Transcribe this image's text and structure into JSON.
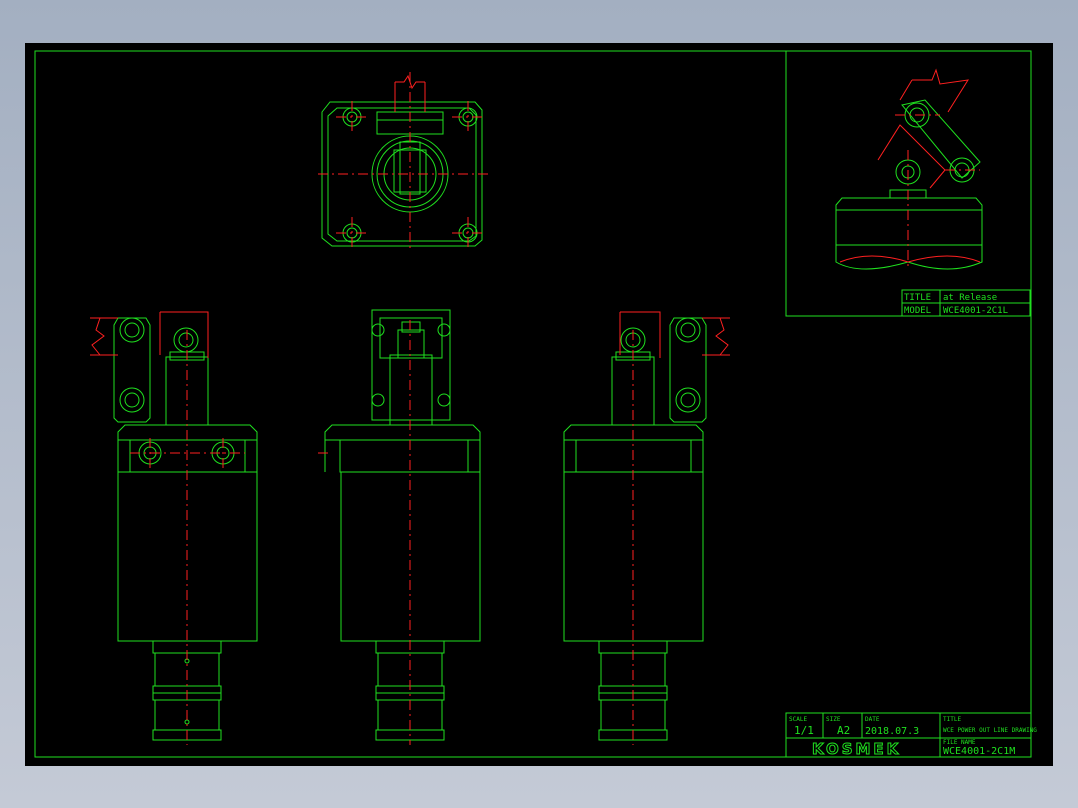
{
  "title_block": {
    "scale_label": "SCALE",
    "scale_value": "1/1",
    "size_label": "SIZE",
    "size_value": "A2",
    "date_label": "DATE",
    "date_value": "2018.07.3",
    "title_label": "TITLE",
    "title_value": "WCE  POWER  OUT  LINE  DRAWING",
    "file_label": "FILE NAME",
    "file_value": "WCE4001-2C1M",
    "company_logo": "KOSMEK"
  },
  "inset_block": {
    "title_label": "TITLE",
    "title_value": "at Release",
    "model_label": "MODEL",
    "model_value": "WCE4001-2C1L"
  },
  "colors": {
    "outline": "#1fe01f",
    "centerline": "#ff2020",
    "background": "#000000"
  }
}
